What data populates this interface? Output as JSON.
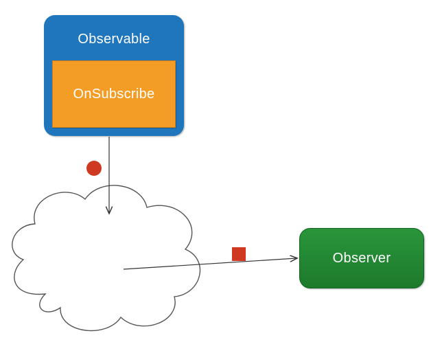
{
  "diagram": {
    "observable": {
      "title": "Observable"
    },
    "onSubscribe": {
      "label": "OnSubscribe"
    },
    "observer": {
      "label": "Observer"
    },
    "markers": {
      "circle": "event-marker-circle",
      "square": "event-marker-square"
    },
    "colors": {
      "observable_bg": "#2076bd",
      "onsubscribe_bg": "#f39c26",
      "observer_bg": "#1d7a2c",
      "event_marker": "#cf3922",
      "stroke": "#444444"
    }
  }
}
